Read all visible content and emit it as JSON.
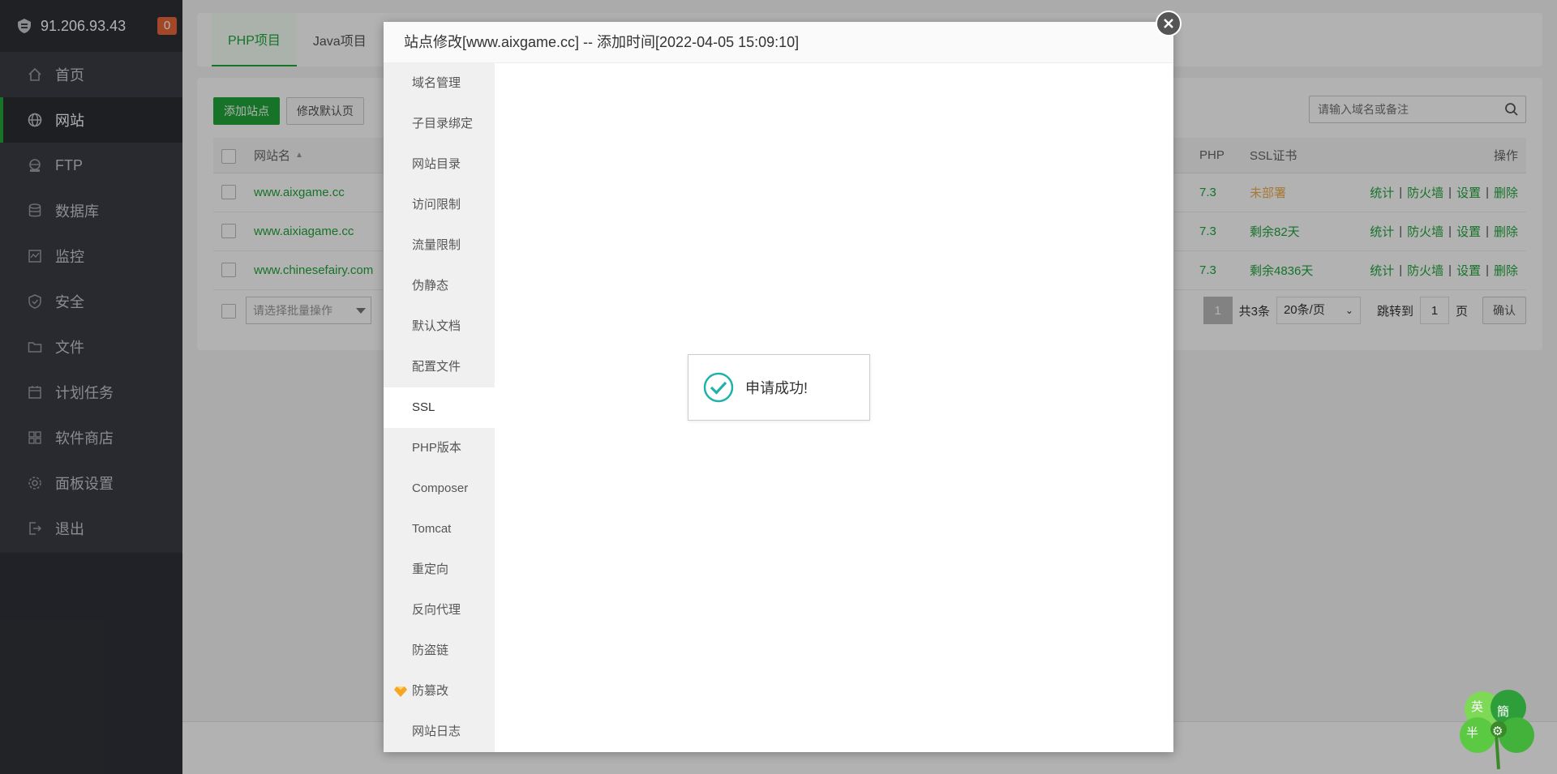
{
  "server": {
    "ip": "91.206.93.43",
    "badge": "0"
  },
  "sidebar": {
    "items": [
      {
        "label": "首页",
        "icon": "home-icon"
      },
      {
        "label": "网站",
        "icon": "globe-icon",
        "active": true
      },
      {
        "label": "FTP",
        "icon": "ftp-icon"
      },
      {
        "label": "数据库",
        "icon": "database-icon"
      },
      {
        "label": "监控",
        "icon": "monitor-icon"
      },
      {
        "label": "安全",
        "icon": "shield-icon"
      },
      {
        "label": "文件",
        "icon": "folder-icon"
      },
      {
        "label": "计划任务",
        "icon": "calendar-icon"
      },
      {
        "label": "软件商店",
        "icon": "apps-icon"
      },
      {
        "label": "面板设置",
        "icon": "gear-icon"
      },
      {
        "label": "退出",
        "icon": "logout-icon"
      }
    ]
  },
  "tabs": {
    "php": "PHP项目",
    "java": "Java项目"
  },
  "toolbar": {
    "add_site": "添加站点",
    "edit_default": "修改默认页",
    "search_placeholder": "请输入域名或备注"
  },
  "table": {
    "headers": {
      "name": "网站名",
      "php": "PHP",
      "ssl": "SSL证书",
      "ops": "操作"
    },
    "rows": [
      {
        "name": "www.aixgame.cc",
        "php": "7.3",
        "ssl": "未部署",
        "ssl_color": "#f0ad4e"
      },
      {
        "name": "www.aixiagame.cc",
        "php": "7.3",
        "ssl": "剩余82天",
        "ssl_color": "#20a53a"
      },
      {
        "name": "www.chinesefairy.com",
        "php": "7.3",
        "ssl": "剩余4836天",
        "ssl_color": "#20a53a"
      }
    ],
    "ops": {
      "stats": "统计",
      "firewall": "防火墙",
      "settings": "设置",
      "delete": "删除",
      "sep": "|"
    }
  },
  "pager": {
    "batch_placeholder": "请选择批量操作",
    "current_page": "1",
    "total": "共3条",
    "per_page": "20条/页",
    "jump_label": "跳转到",
    "jump_value": "1",
    "page_unit": "页",
    "confirm": "确认"
  },
  "modal": {
    "title": "站点修改[www.aixgame.cc] -- 添加时间[2022-04-05 15:09:10]",
    "menu": [
      "域名管理",
      "子目录绑定",
      "网站目录",
      "访问限制",
      "流量限制",
      "伪静态",
      "默认文档",
      "配置文件",
      "SSL",
      "PHP版本",
      "Composer",
      "Tomcat",
      "重定向",
      "反向代理",
      "防盗链",
      "防篡改",
      "网站日志"
    ],
    "active_index": 8
  },
  "toast": {
    "message": "申请成功!"
  },
  "ime": {
    "char1": "英",
    "char2": "簡",
    "char3": "半"
  },
  "colors": {
    "accent": "#20a53a",
    "sidebar": "#3a3d44",
    "badge": "#e8663a",
    "warning": "#f0ad4e",
    "toast_check": "#20b2aa"
  }
}
